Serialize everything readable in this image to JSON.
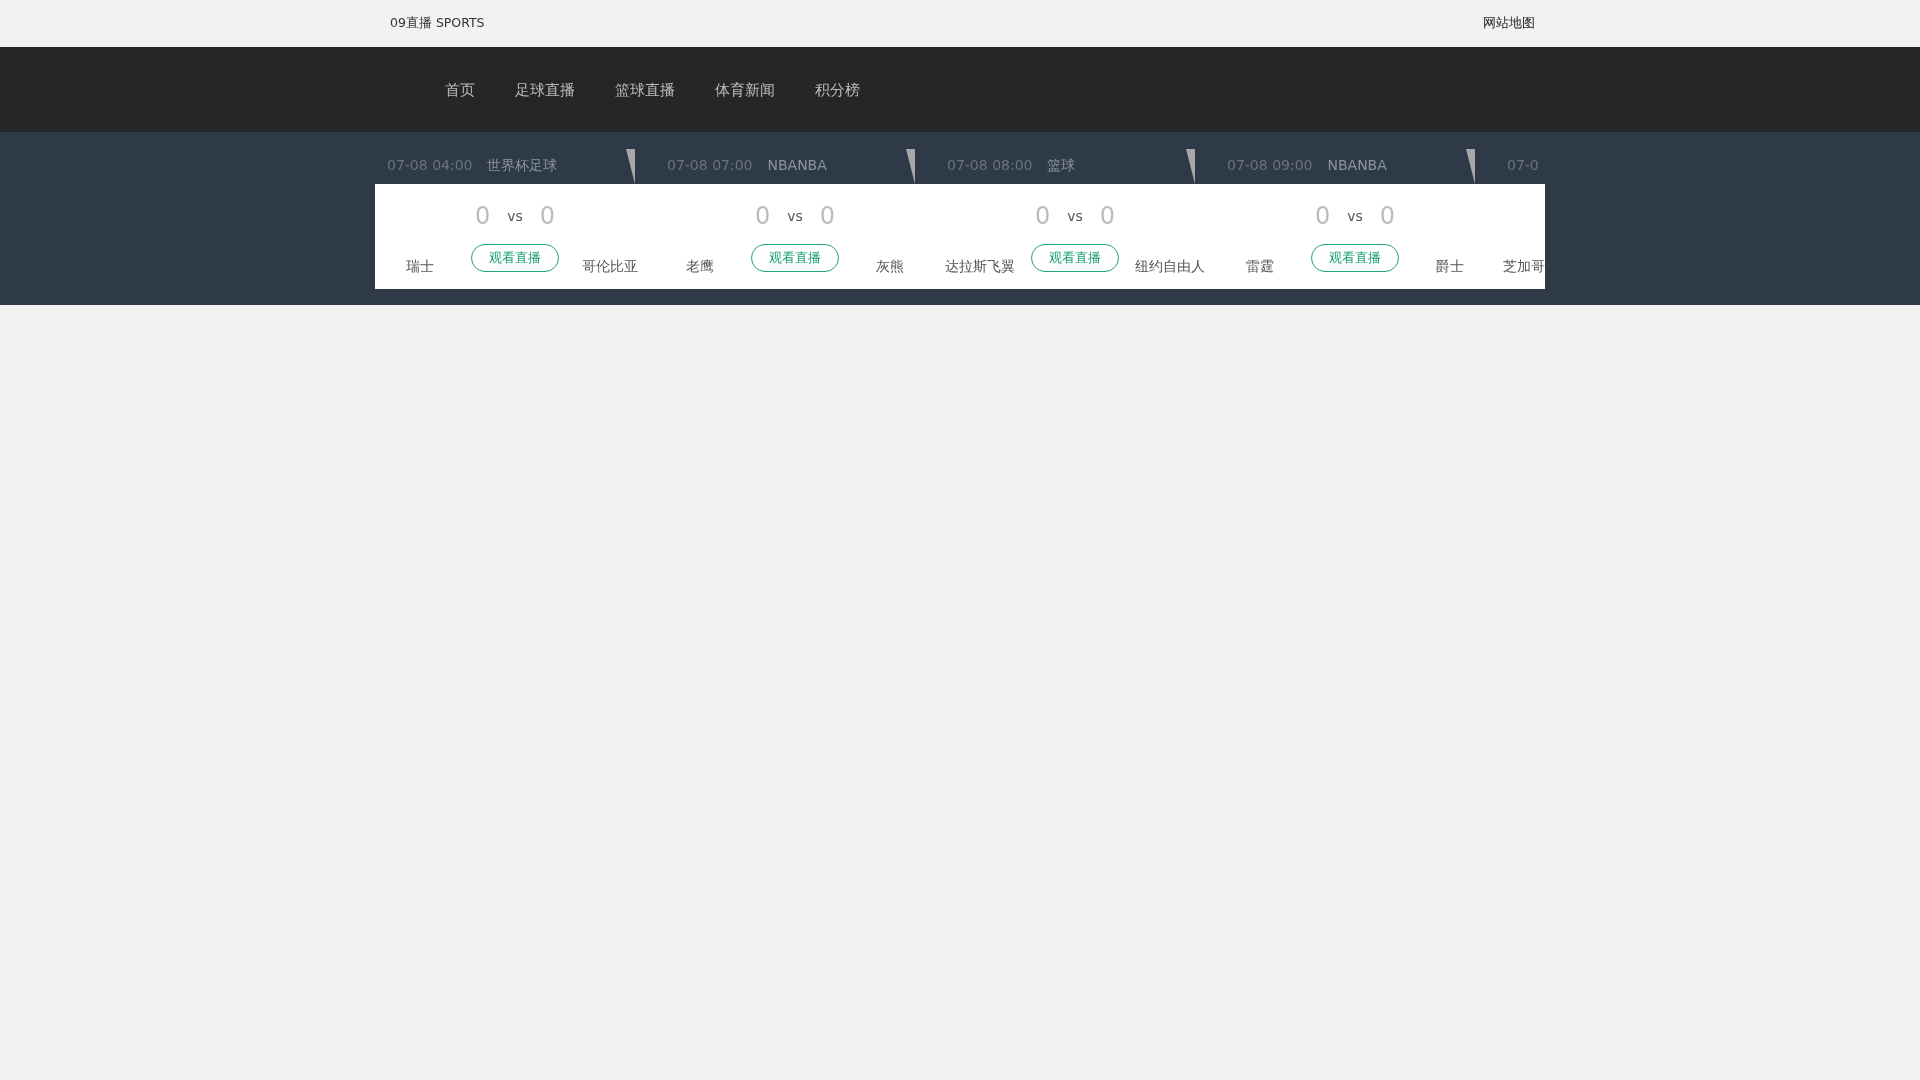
{
  "top_bar": {
    "site_name": "09直播 SPORTS",
    "sitemap_link": "网站地图"
  },
  "nav": {
    "items": [
      "首页",
      "足球直播",
      "篮球直播",
      "体育新闻",
      "积分榜"
    ]
  },
  "matches": [
    {
      "kind": "full",
      "time": "07-08 04:00",
      "league": "世界杯足球",
      "home_team": "瑞士",
      "home_score": "0",
      "vs": "vs",
      "away_score": "0",
      "away_team": "哥伦比亚",
      "button": "观看直播"
    },
    {
      "kind": "full",
      "time": "07-08 07:00",
      "league": "NBANBA",
      "home_team": "老鹰",
      "home_score": "0",
      "vs": "vs",
      "away_score": "0",
      "away_team": "灰熊",
      "button": "观看直播"
    },
    {
      "kind": "full",
      "time": "07-08 08:00",
      "league": "篮球",
      "home_team": "达拉斯飞翼",
      "home_score": "0",
      "vs": "vs",
      "away_score": "0",
      "away_team": "纽约自由人",
      "button": "观看直播"
    },
    {
      "kind": "full",
      "time": "07-08 09:00",
      "league": "NBANBA",
      "home_team": "雷霆",
      "home_score": "0",
      "vs": "vs",
      "away_score": "0",
      "away_team": "爵士",
      "button": "观看直播"
    },
    {
      "kind": "partial",
      "time": "07-0",
      "home_team": "芝加哥"
    }
  ]
}
